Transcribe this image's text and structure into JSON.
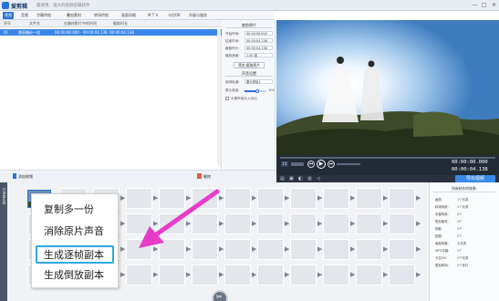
{
  "app": {
    "name": "爱剪辑",
    "slogan": "最易用、强大的视频剪辑软件"
  },
  "window_controls": [
    "—",
    "□",
    "✕"
  ],
  "tabs": [
    {
      "label": "视频",
      "active": true
    },
    {
      "label": "音频",
      "active": false
    },
    {
      "label": "字幕特效",
      "active": false
    },
    {
      "label": "叠加素材",
      "active": false
    },
    {
      "label": "转场特效",
      "active": false
    },
    {
      "label": "画面风格",
      "active": false
    },
    {
      "label": "M T V",
      "active": false
    },
    {
      "label": "卡拉OK",
      "active": false
    },
    {
      "label": "升级与服务",
      "active": false
    }
  ],
  "file_table": {
    "columns": [
      "序号",
      "文件名",
      "在最终影片中的时间",
      "截取时长"
    ],
    "rows": [
      {
        "index": "01",
        "name": "美丽婚纱一组",
        "final_time": "00:00:00.000 - 00:00:04.138",
        "duration": "00:00:04.138"
      }
    ]
  },
  "props": {
    "section_trim": "裁剪原片",
    "start_label": "开始时间:",
    "start_value": "00:00:00.000",
    "end_label": "结束时间:",
    "end_value": "00:00:04.138",
    "duration_label": "截取时长:",
    "duration_value": "00:00:04.138",
    "speed_label": "播放速度:",
    "speed_value": "1.00 倍",
    "preview_trim_button": "预览/截取原片",
    "section_audio": "声音设置",
    "track_label": "使用轨道:",
    "track_value": "原片音轨1",
    "volume_label": "原片音量:",
    "volume_value": "100",
    "mute_label": "头尾声音淡入淡出",
    "confirm_button": "确认修改"
  },
  "left_toolbar": {
    "add_video": "添加视频",
    "delete": "删除"
  },
  "player": {
    "speed_badge": "1X",
    "time_current": "00:00:00.000",
    "time_total": "00:00:04.138",
    "export_button": "导出视频"
  },
  "timeline": {
    "side_label": "已添加片段",
    "slot_arrow": "▶"
  },
  "right_panel": {
    "title": "所有制作的效果:",
    "items": [
      {
        "label": "画质:",
        "value": "1个效果"
      },
      {
        "label": "转场特效:",
        "value": "0个效果"
      },
      {
        "label": "字幕特效:",
        "value": "0个"
      },
      {
        "label": "叠加素材:",
        "value": "0个"
      },
      {
        "label": "相框:",
        "value": "0个"
      },
      {
        "label": "贴图:",
        "value": "0个"
      },
      {
        "label": "画面风格:",
        "value": "无效果"
      },
      {
        "label": "MTV字幕:",
        "value": "0个"
      },
      {
        "label": "卡拉OK:",
        "value": "0个效果"
      },
      {
        "label": "叠加转场:",
        "value": "0个素材"
      }
    ]
  },
  "context_menu": [
    {
      "label": "复制多一份",
      "highlighted": false
    },
    {
      "label": "消除原片声音",
      "highlighted": false
    },
    {
      "label": "生成逐帧副本",
      "highlighted": true
    },
    {
      "label": "生成倒放副本",
      "highlighted": false
    }
  ],
  "colors": {
    "accent": "#2b73d8",
    "selection": "#3a86e8",
    "arrow": "#e83cc8",
    "highlight_border": "#2ea8e0"
  }
}
